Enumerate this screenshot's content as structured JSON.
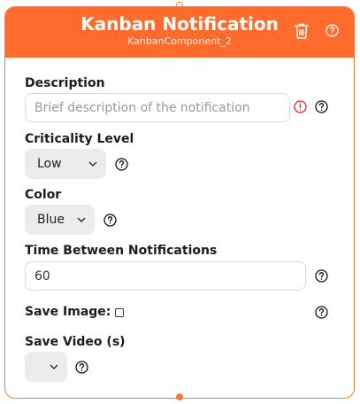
{
  "node": {
    "title": "Kanban Notification",
    "subtitle": "KanbanComponent_2",
    "accent_color": "#ff6b2c",
    "header_icons": [
      "trash-icon",
      "help-icon"
    ]
  },
  "fields": {
    "description": {
      "label": "Description",
      "placeholder": "Brief description of the notification",
      "value": ""
    },
    "criticality": {
      "label": "Criticality Level",
      "selected": "Low"
    },
    "color": {
      "label": "Color",
      "selected": "Blue"
    },
    "time_between": {
      "label": "Time Between Notifications",
      "value": "60"
    },
    "save_image": {
      "label": "Save Image:",
      "checked": false
    },
    "save_video": {
      "label": "Save Video (s)",
      "selected": ""
    }
  }
}
